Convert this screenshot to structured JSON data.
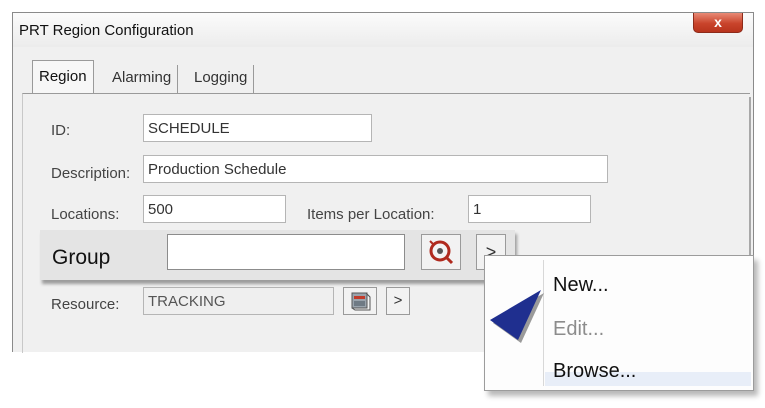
{
  "window": {
    "title": "PRT Region Configuration",
    "close_label": "x"
  },
  "tabs": [
    {
      "label": "Region",
      "active": true
    },
    {
      "label": "Alarming",
      "active": false
    },
    {
      "label": "Logging",
      "active": false
    }
  ],
  "form": {
    "id_label": "ID:",
    "id_value": "SCHEDULE",
    "description_label": "Description:",
    "description_value": "Production Schedule",
    "locations_label": "Locations:",
    "locations_value": "500",
    "items_per_location_label": "Items per Location:",
    "items_per_location_value": "1",
    "resource_label": "Resource:",
    "resource_value": "TRACKING",
    "resource_arrow": ">"
  },
  "group": {
    "label": "Group",
    "value": "",
    "arrow": ">"
  },
  "context_menu": {
    "items": [
      {
        "label": "New...",
        "enabled": true
      },
      {
        "label": "Edit...",
        "enabled": false
      },
      {
        "label": "Browse...",
        "enabled": true
      }
    ]
  },
  "colors": {
    "dialog_bg": "#f0f0f0",
    "close_button": "#c9442b",
    "pointer_arrow": "#1f2f8f"
  }
}
